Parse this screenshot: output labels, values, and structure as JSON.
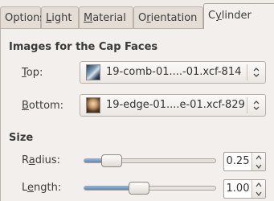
{
  "tabs": [
    {
      "pre": "Options",
      "mn": "",
      "post": ""
    },
    {
      "pre": "",
      "mn": "L",
      "post": "ight"
    },
    {
      "pre": "",
      "mn": "M",
      "post": "aterial"
    },
    {
      "pre": "O",
      "mn": "r",
      "post": "ientation"
    },
    {
      "pre": "C",
      "mn": "y",
      "post": "linder"
    }
  ],
  "active_tab": "Cylinder",
  "cap_faces": {
    "title": "Images for the Cap Faces",
    "top": {
      "mn": "T",
      "label_rest": "op:",
      "value": "19-comb-01....-01.xcf-814"
    },
    "bottom": {
      "mn": "B",
      "label_rest": "ottom:",
      "value": "19-edge-01....e-01.xcf-829"
    }
  },
  "size": {
    "title": "Size",
    "radius": {
      "pre": "R",
      "mn": "a",
      "post": "dius:",
      "value": "0.25",
      "fraction": 0.15
    },
    "length": {
      "pre": "L",
      "mn": "e",
      "post": "ngth:",
      "value": "1.00",
      "fraction": 0.4
    }
  }
}
